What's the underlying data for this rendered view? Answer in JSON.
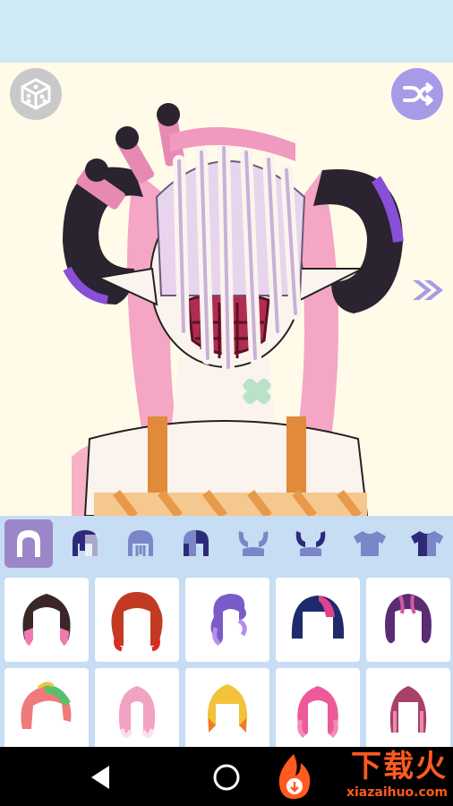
{
  "app": {
    "accent_color": "#9b86c9",
    "tab_bg_color": "#c7ddf3"
  },
  "canvas": {
    "random_button_icon": "dice-icon",
    "shuffle_button_icon": "shuffle-icon",
    "next_icon": "double-chevron-right-icon"
  },
  "tabs": [
    {
      "icon": "back-hair-icon",
      "active": true
    },
    {
      "icon": "hair-front-dark-icon",
      "active": false
    },
    {
      "icon": "hair-bangs-icon",
      "active": false
    },
    {
      "icon": "hair-side-dark-icon",
      "active": false
    },
    {
      "icon": "horns-icon",
      "active": false
    },
    {
      "icon": "horns-dark-icon",
      "active": false
    },
    {
      "icon": "shirt-icon",
      "active": false
    },
    {
      "icon": "shirt-dark-icon",
      "active": false
    }
  ],
  "options": [
    {
      "icon": "hair-option-icon",
      "colors": [
        "#3a2626",
        "#f07ab0"
      ]
    },
    {
      "icon": "hair-option-icon",
      "colors": [
        "#c23a24",
        "#e0281e"
      ]
    },
    {
      "icon": "hair-option-icon",
      "colors": [
        "#7a5cc8",
        "#b78cf0"
      ]
    },
    {
      "icon": "hair-option-icon",
      "colors": [
        "#1d2a6b",
        "#e0428e"
      ]
    },
    {
      "icon": "hair-option-icon",
      "colors": [
        "#5b2b74",
        "#d45aa0"
      ]
    },
    {
      "icon": "hair-option-icon",
      "colors": [
        "#f07a7a",
        "#58c06a"
      ]
    },
    {
      "icon": "hair-option-icon",
      "colors": [
        "#f2a2c2",
        "#fce0ec"
      ]
    },
    {
      "icon": "hair-option-icon",
      "colors": [
        "#f2c23a",
        "#f07a2a"
      ]
    },
    {
      "icon": "hair-option-icon",
      "colors": [
        "#ec5a9a",
        "#f58ab8"
      ]
    },
    {
      "icon": "hair-option-icon",
      "colors": [
        "#a8406a",
        "#e88aac"
      ]
    }
  ],
  "navbar": {
    "back_icon": "back-triangle-icon",
    "home_icon": "home-circle-icon"
  },
  "watermark": {
    "title": "下载火",
    "subtitle": "xiazaihuo.com"
  }
}
